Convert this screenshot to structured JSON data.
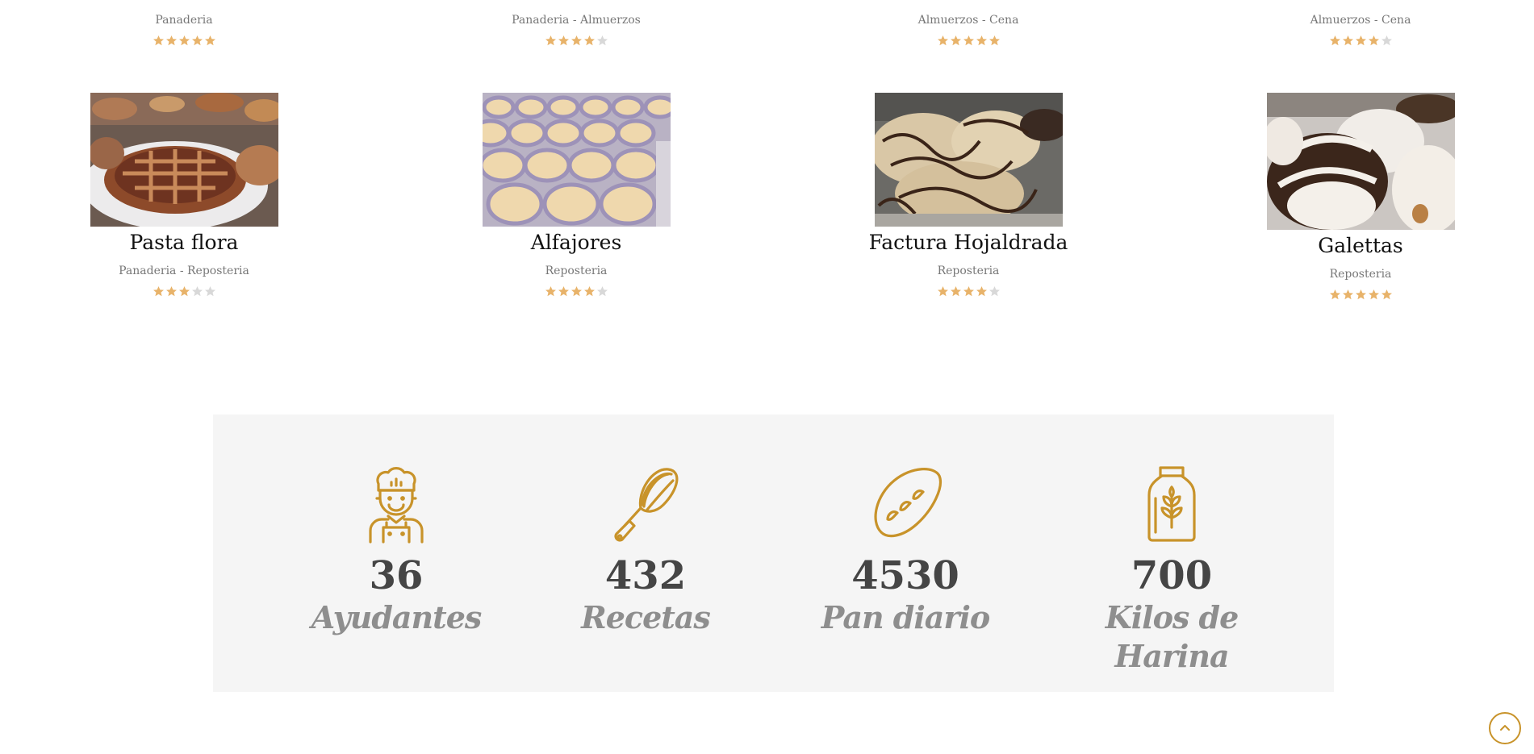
{
  "top_row": [
    {
      "cats": "Panaderia",
      "rating": 5
    },
    {
      "cats": "Panaderia - Almuerzos",
      "rating": 4
    },
    {
      "cats": "Almuerzos - Cena",
      "rating": 5
    },
    {
      "cats": "Almuerzos - Cena",
      "rating": 4
    }
  ],
  "products": [
    {
      "title": "Pasta flora",
      "cats": "Panaderia - Reposteria",
      "rating": 3,
      "image": "pasta-flora-photo"
    },
    {
      "title": "Alfajores",
      "cats": "Reposteria",
      "rating": 4,
      "image": "alfajores-photo"
    },
    {
      "title": "Factura Hojaldrada",
      "cats": "Reposteria",
      "rating": 4,
      "image": "factura-photo"
    },
    {
      "title": "Galettas",
      "cats": "Reposteria",
      "rating": 5,
      "image": "galettas-photo"
    }
  ],
  "stats": [
    {
      "value": "36",
      "label": "Ayudantes",
      "icon": "chef-icon"
    },
    {
      "value": "432",
      "label": "Recetas",
      "icon": "whisk-icon"
    },
    {
      "value": "4530",
      "label": "Pan diario",
      "icon": "bread-icon"
    },
    {
      "value": "700",
      "label": "Kilos de Harina",
      "icon": "flour-jar-icon"
    }
  ],
  "colors": {
    "accent": "#c8932a",
    "star_on": "#e8b36a",
    "star_off": "#d8d8d8",
    "stats_bg": "#f5f5f5"
  },
  "scroll_top_icon": "chevron-up-icon"
}
